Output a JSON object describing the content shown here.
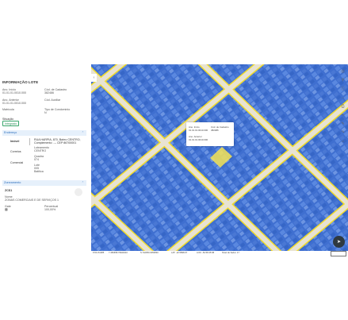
{
  "panel": {
    "title": "INFORMAÇÃO LOTE",
    "fields": {
      "ano_inicio_label": "Ano. Início",
      "ano_inicio_value": "01.01.01.0010.000",
      "cod_cadastro_label": "Cód. de Cadastro",
      "cod_cadastro_value": "382486",
      "ano_anterior_label": "Ano. Anterior",
      "ano_anterior_value": "01.01.01.0010.000",
      "cod_auxiliar_label": "Cód. Auxiliar",
      "cod_auxiliar_value": "",
      "matricula_label": "Matrícula",
      "matricula_value": "",
      "tipo_condominio_label": "Tipo de Condomínio",
      "tipo_condominio_value": "N",
      "situacao_label": "Situação",
      "situacao_value": "Integrado"
    },
    "endereco": {
      "header": "Endereço",
      "tipo": "Imóvel",
      "endereco_value": "RUA HARPIA, 870, Bairro CENTRO, Complemento: --- CEP 86700001",
      "loteamento_label": "Loteamento",
      "loteamento_value": "CENTRO",
      "quadra_label": "Quadra",
      "quadra_value": "074",
      "lote_label": "Lote",
      "lote_value": "005",
      "bairro_label": "Bairros",
      "bairro_value": "Batitica",
      "row_correios": "Correios",
      "row_comercial": "Comercial"
    },
    "zoneamento": {
      "header": "Zoneamento",
      "codigo": "ZCS1",
      "nome_label": "Nome",
      "nome_value": "ZONAS COMERCIAIS E DE SERVIÇOS 1",
      "gate_label": "Gate",
      "gate_value": "",
      "percentual_label": "Percentual",
      "percentual_value": "100,00%"
    }
  },
  "popup": {
    "ano_inicio_label": "Ano. Início",
    "ano_inicio_value": "01.01.01.0010.000",
    "cod_label": "Cód. de Cadastro",
    "cod_value": "382486",
    "ano_anterior_label": "Ano. Anterior",
    "ano_anterior_value": "01.01.01.0010.000"
  },
  "statusbar": {
    "coords1": "6701.51385",
    "coords2": "7.456658.79620410",
    "coords3": "S.742050.0050830",
    "lat": "LAT: -22.5898.67",
    "lon": "LON: -52.58.35.58",
    "nivel": "Nível de Salvo: 17"
  },
  "colors": {
    "map_parcel": "#4f7ed6",
    "road_edge": "#f2dc2a",
    "road": "#e8e3d2",
    "selected": "#f6e455"
  }
}
